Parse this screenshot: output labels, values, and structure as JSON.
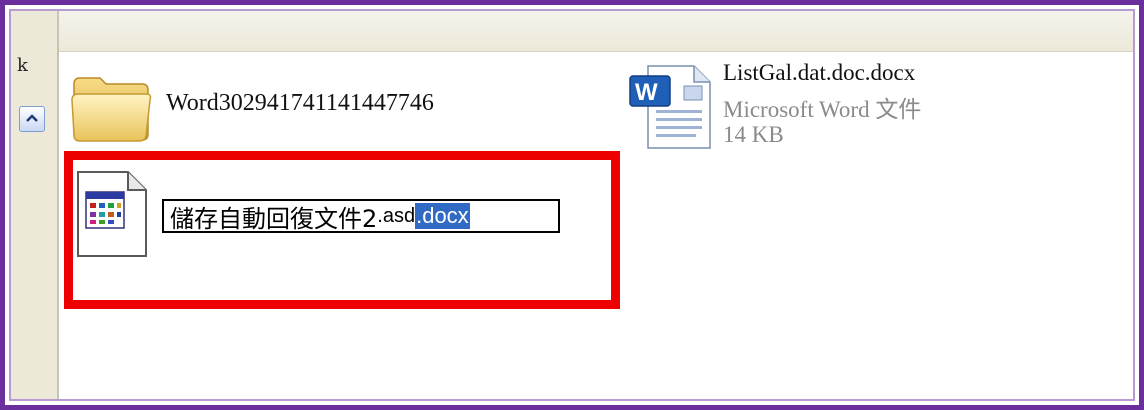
{
  "left_pane": {
    "clipped_text": "k",
    "collapse_icon": "chevron-up-icon"
  },
  "files": [
    {
      "name": "Word302941741141447746",
      "icon": "folder-icon"
    },
    {
      "name": "ListGal.dat.doc.docx",
      "type": "Microsoft Word 文件",
      "size": "14 KB",
      "icon": "word-document-icon"
    }
  ],
  "rename": {
    "icon": "generic-application-file-icon",
    "value_base": "儲存自動回復文件2",
    "value_mid": ".asd",
    "value_selected": ".docx"
  },
  "colors": {
    "frame_border": "#6a2f9c",
    "highlight": "#ee0000",
    "selection": "#316ac5"
  }
}
